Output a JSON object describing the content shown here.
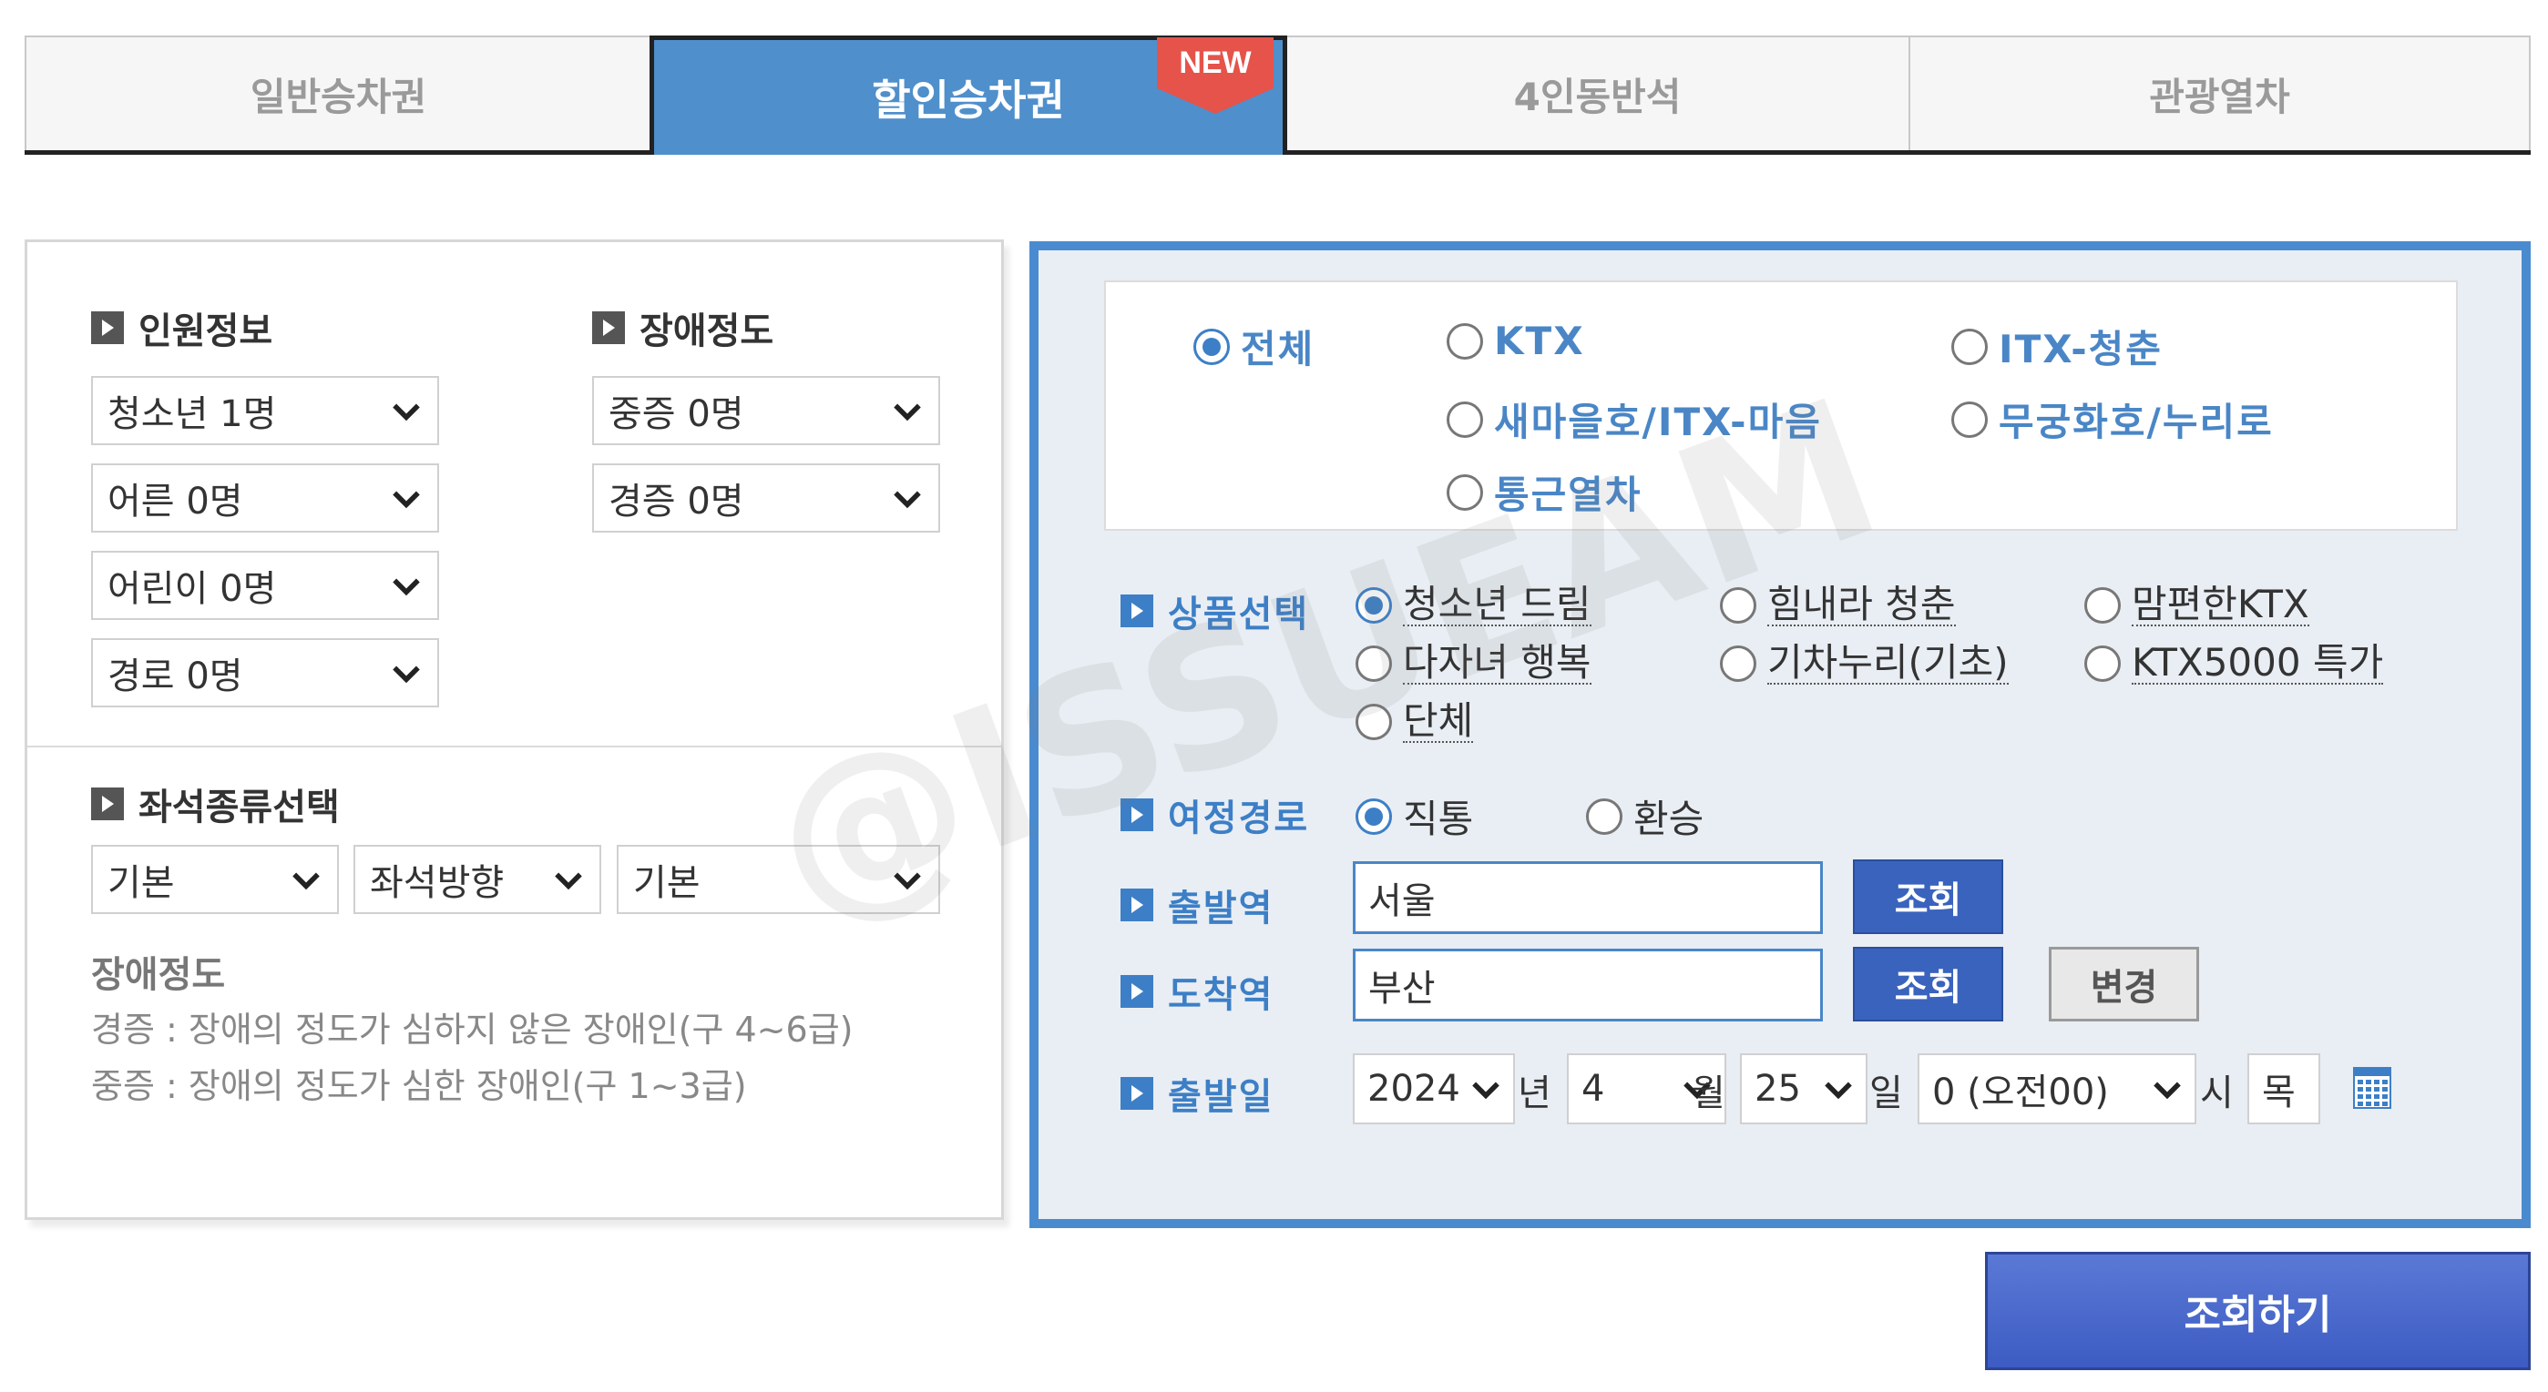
{
  "tabs": [
    {
      "label": "일반승차권",
      "active": false
    },
    {
      "label": "할인승차권",
      "active": true,
      "badge": "NEW"
    },
    {
      "label": "4인동반석",
      "active": false
    },
    {
      "label": "관광열차",
      "active": false
    }
  ],
  "left": {
    "passenger_title": "인원정보",
    "disability_title": "장애정도",
    "passengers": [
      "청소년 1명",
      "어른 0명",
      "어린이 0명",
      "경로 0명"
    ],
    "disability": [
      "중증 0명",
      "경증 0명"
    ],
    "seat_title": "좌석종류선택",
    "seat_selects": [
      "기본",
      "좌석방향",
      "기본"
    ],
    "desc_title": "장애정도",
    "desc_lines": [
      "경증 : 장애의 정도가 심하지 않은 장애인(구 4~6급)",
      "중증 : 장애의 정도가 심한 장애인(구 1~3급)"
    ]
  },
  "trains": {
    "selected": "전체",
    "options": [
      "전체",
      "KTX",
      "ITX-청춘",
      "새마을호/ITX-마음",
      "무궁화호/누리로",
      "통근열차"
    ]
  },
  "product": {
    "label": "상품선택",
    "selected": "청소년 드림",
    "options": [
      "청소년 드림",
      "힘내라 청춘",
      "맘편한KTX",
      "다자녀 행복",
      "기차누리(기초)",
      "KTX5000 특가",
      "단체"
    ]
  },
  "route": {
    "label": "여정경로",
    "selected": "직통",
    "options": [
      "직통",
      "환승"
    ]
  },
  "departure": {
    "label": "출발역",
    "value": "서울",
    "button": "조회"
  },
  "arrival": {
    "label": "도착역",
    "value": "부산",
    "button": "조회",
    "swap_button": "변경"
  },
  "date": {
    "label": "출발일",
    "year": "2024",
    "year_unit": "년",
    "month": "4",
    "month_unit": "월",
    "day": "25",
    "day_unit": "일",
    "hour": "0 (오전00)",
    "hour_unit": "시",
    "weekday": "목",
    "calendar_icon": "calendar-icon"
  },
  "submit_label": "조회하기",
  "watermark": "@ISSUEAM",
  "colors": {
    "accent": "#4f8fcb",
    "border_blue": "#4a8bd0",
    "button_blue": "#3a63bd",
    "badge_red": "#e5534b"
  }
}
